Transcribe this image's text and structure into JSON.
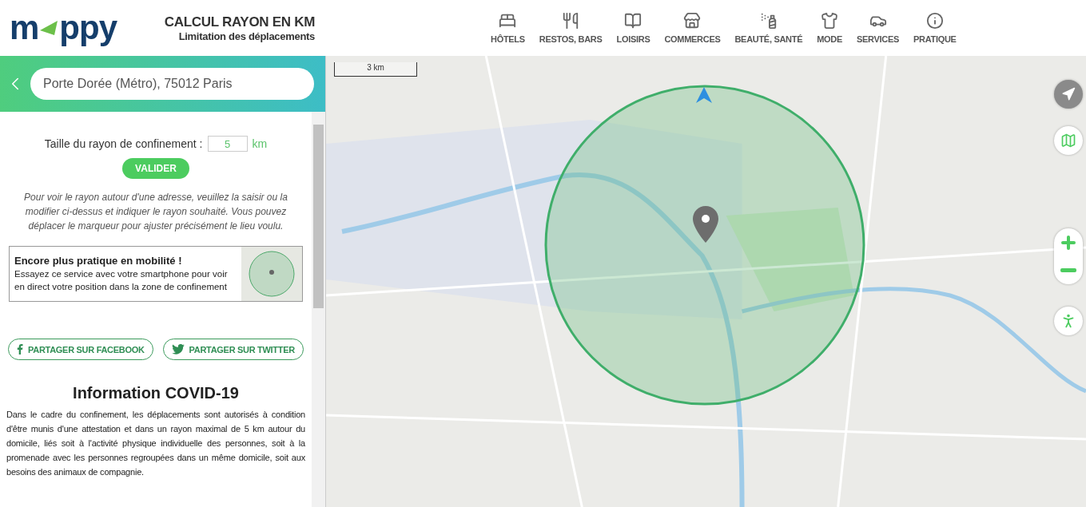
{
  "header": {
    "logo": {
      "left": "m",
      "right": "ppy"
    },
    "title": "CALCUL RAYON EN KM",
    "subtitle": "Limitation des déplacements"
  },
  "nav": [
    {
      "label": "HÔTELS"
    },
    {
      "label": "RESTOS, BARS"
    },
    {
      "label": "LOISIRS"
    },
    {
      "label": "COMMERCES"
    },
    {
      "label": "BEAUTÉ, SANTÉ"
    },
    {
      "label": "MODE"
    },
    {
      "label": "SERVICES"
    },
    {
      "label": "PRATIQUE"
    }
  ],
  "search": {
    "value": "Porte Dorée (Métro), 75012 Paris"
  },
  "radius": {
    "label": "Taille du rayon de confinement :",
    "value": "5",
    "unit": "km",
    "button": "VALIDER"
  },
  "help": "Pour voir le rayon autour d'une adresse, veuillez la saisir ou la modifier ci-dessus et indiquer le rayon souhaité. Vous pouvez déplacer le marqueur pour ajuster précisément le lieu voulu.",
  "promo": {
    "title": "Encore plus pratique en mobilité !",
    "text": "Essayez ce service avec votre smartphone pour voir en direct votre position dans la zone de confinement"
  },
  "share": [
    {
      "label": "PARTAGER SUR FACEBOOK"
    },
    {
      "label": "PARTAGER SUR TWITTER"
    }
  ],
  "info": {
    "title": "Information COVID-19",
    "text": "Dans le cadre du confinement, les déplacements sont autorisés à condition d'être munis d'une attestation et dans un rayon maximal de 5 km autour du domicile, liés soit à l'activité physique individuelle des personnes, soit à la promenade avec les personnes regroupées dans un même domicile, soit aux besoins des animaux de compagnie."
  },
  "map": {
    "scale": "3 km"
  }
}
